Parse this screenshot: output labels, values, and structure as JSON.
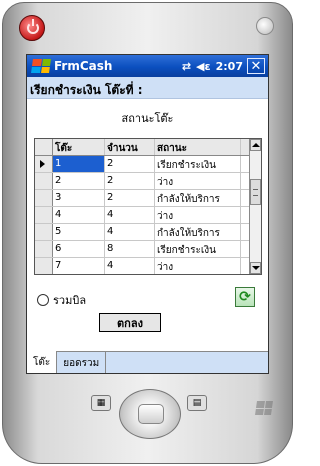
{
  "titlebar": {
    "app_title": "FrmCash",
    "time": "2:07",
    "close_label": "✕",
    "connectivity_glyph": "⇄",
    "volume_glyph": "◀ε"
  },
  "form": {
    "header": "เรียกชำระเงิน  โต๊ะที่ :",
    "grid_caption": "สถานะโต๊ะ"
  },
  "grid": {
    "columns": [
      "โต๊ะ",
      "จำนวน",
      "สถานะ"
    ],
    "rows": [
      [
        "1",
        "2",
        "เรียกชำระเงิน"
      ],
      [
        "2",
        "2",
        "ว่าง"
      ],
      [
        "3",
        "2",
        "กำลังให้บริการ"
      ],
      [
        "4",
        "4",
        "ว่าง"
      ],
      [
        "5",
        "4",
        "กำลังให้บริการ"
      ],
      [
        "6",
        "8",
        "เรียกชำระเงิน"
      ],
      [
        "7",
        "4",
        "ว่าง"
      ]
    ]
  },
  "controls": {
    "radio_label": "รวมบิล",
    "ok_label": "ตกลง",
    "refresh_glyph": "⟳"
  },
  "tabs": [
    "โต๊ะ",
    "ยอดรวม"
  ],
  "colors": {
    "titlebar": "#0b4fbf",
    "header_bg": "#cfe0f6",
    "selection": "#1c5fd0"
  }
}
